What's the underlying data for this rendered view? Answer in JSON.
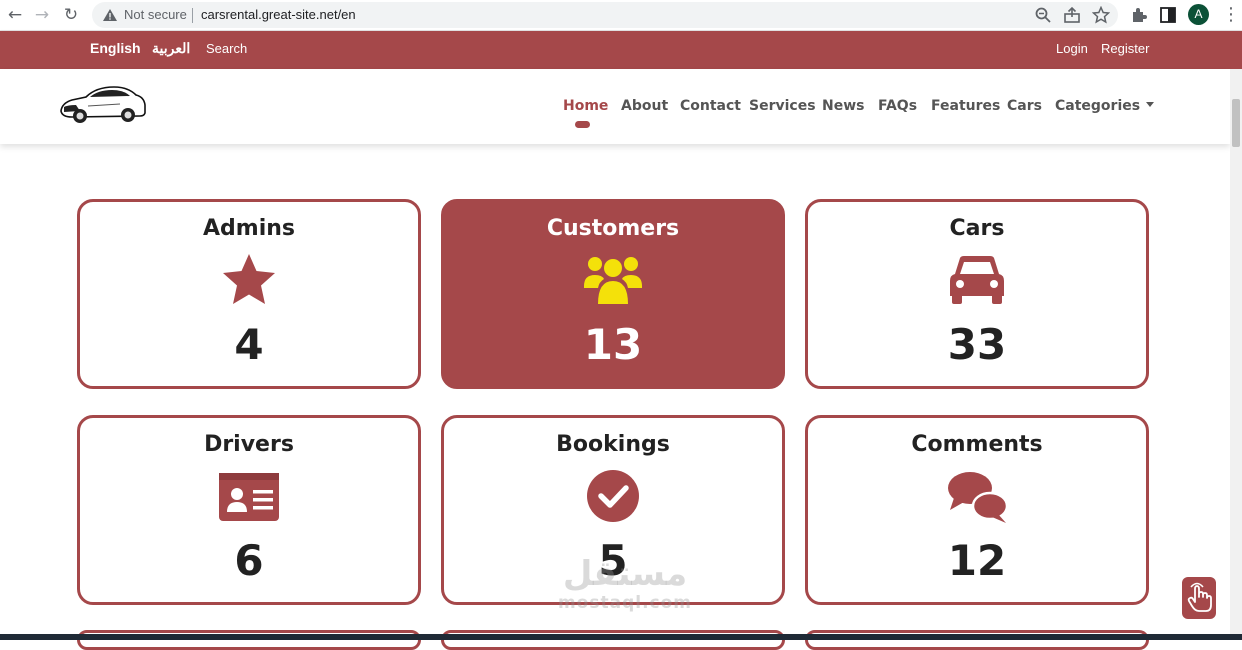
{
  "browser": {
    "security_label": "Not secure",
    "url": "carsrental.great-site.net/en",
    "profile_initial": "A"
  },
  "topbar": {
    "lang_en": "English",
    "lang_ar": "العربية",
    "search": "Search",
    "login": "Login",
    "register": "Register"
  },
  "nav": {
    "items": [
      {
        "label": "Home"
      },
      {
        "label": "About"
      },
      {
        "label": "Contact"
      },
      {
        "label": "Services"
      },
      {
        "label": "News"
      },
      {
        "label": "FAQs"
      },
      {
        "label": "Features"
      },
      {
        "label": "Cars"
      },
      {
        "label": "Categories"
      }
    ],
    "active": "Home"
  },
  "stats": [
    {
      "title": "Admins",
      "value": "4",
      "icon": "star-icon"
    },
    {
      "title": "Customers",
      "value": "13",
      "icon": "users-icon"
    },
    {
      "title": "Cars",
      "value": "33",
      "icon": "car-icon"
    },
    {
      "title": "Drivers",
      "value": "6",
      "icon": "id-card-icon"
    },
    {
      "title": "Bookings",
      "value": "5",
      "icon": "check-circle-icon"
    },
    {
      "title": "Comments",
      "value": "12",
      "icon": "comments-icon"
    }
  ],
  "watermark": {
    "arabic": "مستقل",
    "latin": "mostaql.com"
  },
  "colors": {
    "brand": "#a5484a",
    "icon_highlight": "#f4e10a",
    "text_dark": "#222222"
  }
}
